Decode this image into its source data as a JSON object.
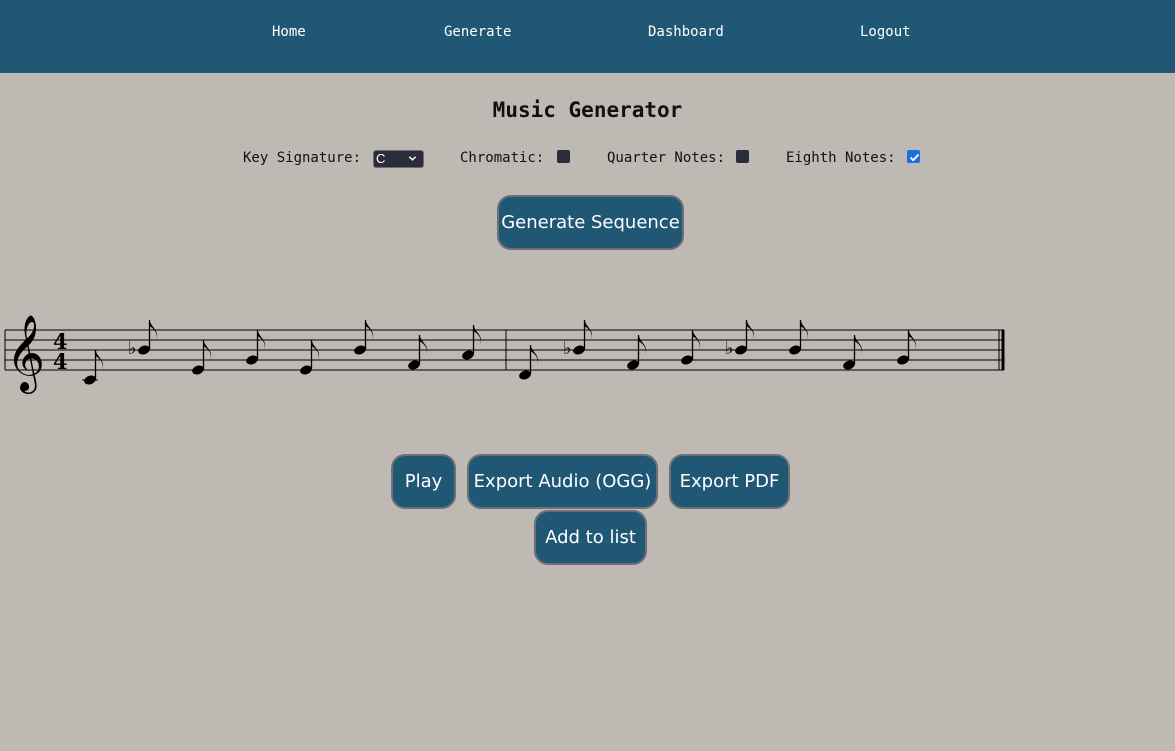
{
  "nav": {
    "home": "Home",
    "generate": "Generate",
    "dashboard": "Dashboard",
    "logout": "Logout"
  },
  "page": {
    "title": "Music Generator"
  },
  "options": {
    "key_signature_label": "Key Signature:",
    "key_signature_value": "C",
    "chromatic_label": "Chromatic:",
    "chromatic_checked": false,
    "quarter_notes_label": "Quarter Notes:",
    "quarter_notes_checked": false,
    "eighth_notes_label": "Eighth Notes:",
    "eighth_notes_checked": true
  },
  "buttons": {
    "generate": "Generate Sequence",
    "play": "Play",
    "export_audio": "Export Audio (OGG)",
    "export_pdf": "Export PDF",
    "add_to_list": "Add to list"
  },
  "score": {
    "time_signature": [
      "4",
      "4"
    ],
    "clef": "treble",
    "measures": [
      [
        {
          "pitch": "C4",
          "dur": "eighth"
        },
        {
          "pitch": "Bb4",
          "dur": "eighth"
        },
        {
          "pitch": "E4",
          "dur": "eighth"
        },
        {
          "pitch": "G4",
          "dur": "eighth"
        },
        {
          "pitch": "E4",
          "dur": "eighth"
        },
        {
          "pitch": "B4",
          "dur": "eighth"
        },
        {
          "pitch": "F4",
          "dur": "eighth"
        },
        {
          "pitch": "A4",
          "dur": "eighth"
        }
      ],
      [
        {
          "pitch": "D4",
          "dur": "eighth"
        },
        {
          "pitch": "Bb4",
          "dur": "eighth"
        },
        {
          "pitch": "F4",
          "dur": "eighth"
        },
        {
          "pitch": "G4",
          "dur": "eighth"
        },
        {
          "pitch": "Bb4",
          "dur": "eighth"
        },
        {
          "pitch": "B4",
          "dur": "eighth"
        },
        {
          "pitch": "F4",
          "dur": "eighth"
        },
        {
          "pitch": "G4",
          "dur": "eighth"
        }
      ]
    ]
  },
  "colors": {
    "nav_bg": "#205775",
    "page_bg": "#beb9b3",
    "button_bg": "#205775",
    "checkbox_checked": "#1a6fe0"
  }
}
